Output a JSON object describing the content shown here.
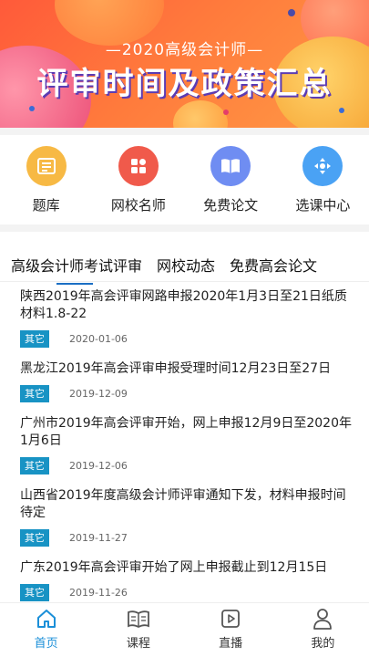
{
  "banner": {
    "subtitle": "—2020高级会计师—",
    "title": "评审时间及政策汇总"
  },
  "quicknav": [
    {
      "label": "题库",
      "icon": "list-icon",
      "color": "#f7b944"
    },
    {
      "label": "网校名师",
      "icon": "grid-icon",
      "color": "#f05a4b"
    },
    {
      "label": "免费论文",
      "icon": "book-icon",
      "color": "#6f8df2"
    },
    {
      "label": "选课中心",
      "icon": "compass-icon",
      "color": "#4aa2f4"
    }
  ],
  "tabs": [
    {
      "label": "高级会计师考试评审",
      "active": true
    },
    {
      "label": "网校动态",
      "active": false
    },
    {
      "label": "免费高会论文",
      "active": false
    }
  ],
  "articles": [
    {
      "title": "陕西2019年高会评审网路申报2020年1月3日至21日纸质材料1.8-22",
      "tag": "其它",
      "date": "2020-01-06"
    },
    {
      "title": "黑龙江2019年高会评审申报受理时间12月23日至27日",
      "tag": "其它",
      "date": "2019-12-09"
    },
    {
      "title": "广州市2019年高会评审开始，网上申报12月9日至2020年1月6日",
      "tag": "其它",
      "date": "2019-12-06"
    },
    {
      "title": "山西省2019年度高级会计师评审通知下发，材料申报时间待定",
      "tag": "其它",
      "date": "2019-11-27"
    },
    {
      "title": "广东2019年高会评审开始了网上申报截止到12月15日",
      "tag": "其它",
      "date": "2019-11-26"
    }
  ],
  "tabbar": [
    {
      "label": "首页",
      "icon": "home-icon",
      "active": true
    },
    {
      "label": "课程",
      "icon": "book-open-icon",
      "active": false
    },
    {
      "label": "直播",
      "icon": "play-icon",
      "active": false
    },
    {
      "label": "我的",
      "icon": "user-icon",
      "active": false
    }
  ],
  "colors": {
    "accent": "#1b8fd8",
    "tag": "#1893c4",
    "banner": "#ff6a3c"
  }
}
